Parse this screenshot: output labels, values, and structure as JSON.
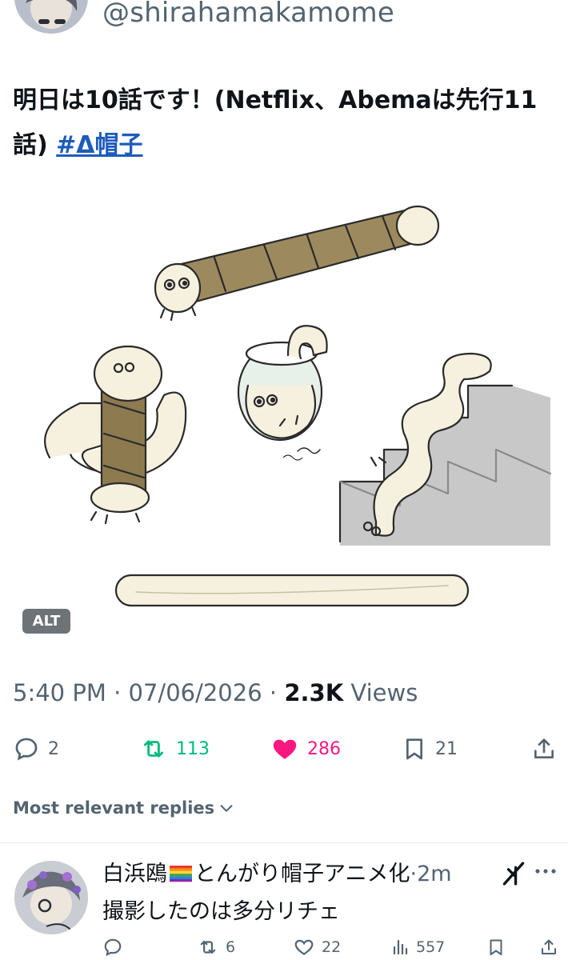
{
  "author": {
    "handle": "@shirahamakamome",
    "avatar": "avatar-illustration"
  },
  "tweet": {
    "text_line1": "明日は10話です！(Netflix、Abemaは先行11",
    "text_line2": "話) ",
    "hashtag": "#Δ帽子",
    "media_alt_badge": "ALT",
    "time": "5:40 PM",
    "date": "07/06/2026",
    "separator": "·",
    "views_count": "2.3K",
    "views_label": "Views"
  },
  "actions": {
    "replies": "2",
    "reposts": "113",
    "likes": "286",
    "bookmarks": "21",
    "repost_color": "#00ba7c",
    "like_color": "#f91880"
  },
  "replies_header": {
    "label": "Most relevant replies"
  },
  "reply": {
    "name_prefix": "白浜鴎",
    "flag_icon": "rainbow-flag-icon",
    "name_suffix": "とんがり帽子アニメ化",
    "dot": "·",
    "time": "2m",
    "text": "撮影したのは多分リチェ",
    "retweets": "6",
    "likes": "22",
    "views": "557"
  }
}
